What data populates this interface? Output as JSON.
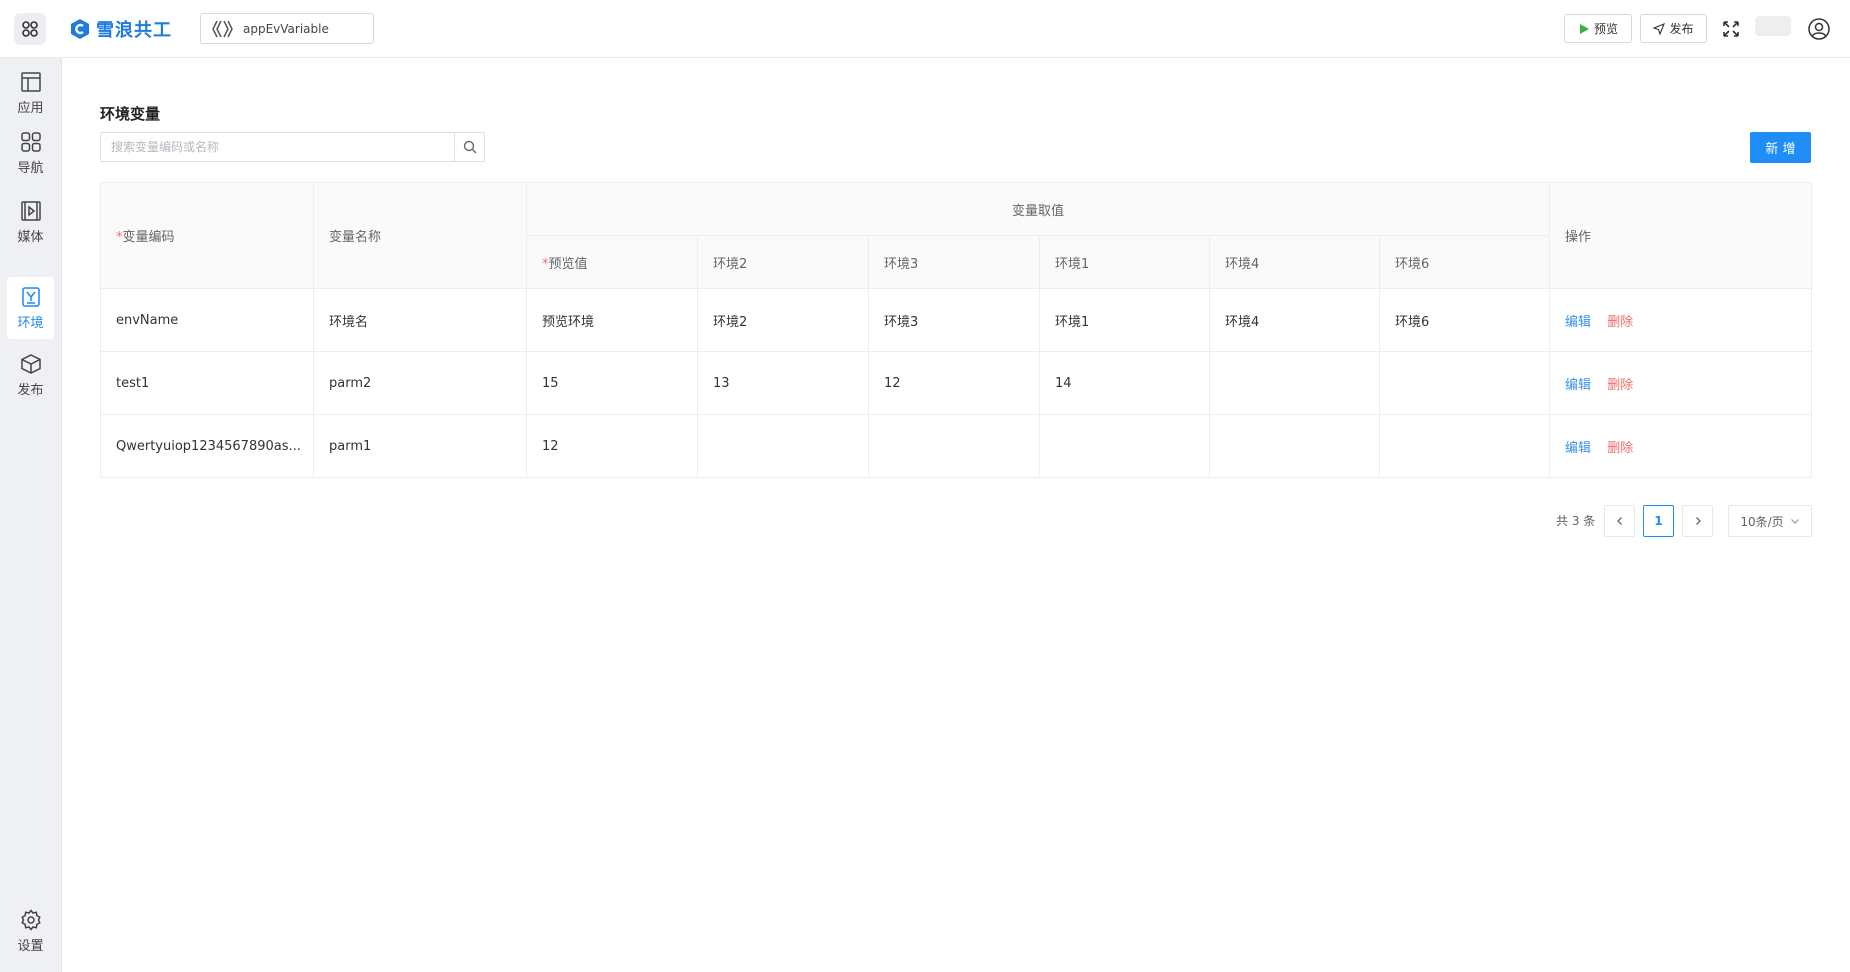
{
  "header": {
    "brand": "雪浪共工",
    "app_name": "appEvVariable",
    "preview_label": "预览",
    "publish_label": "发布"
  },
  "sidebar": {
    "items": [
      {
        "label": "应用",
        "icon": "layout-icon"
      },
      {
        "label": "导航",
        "icon": "grid-icon"
      },
      {
        "label": "媒体",
        "icon": "media-icon"
      },
      {
        "label": "环境",
        "icon": "env-icon",
        "active": true
      },
      {
        "label": "发布",
        "icon": "box-icon"
      }
    ],
    "settings_label": "设置"
  },
  "page": {
    "title": "环境变量",
    "search_placeholder": "搜索变量编码或名称",
    "add_label": "新 增"
  },
  "table": {
    "headers": {
      "code_req": "*",
      "code": "变量编码",
      "name": "变量名称",
      "values_group": "变量取值",
      "preview_req": "*",
      "preview": "预览值",
      "env2": "环境2",
      "env3": "环境3",
      "env1": "环境1",
      "env4": "环境4",
      "env6": "环境6",
      "ops": "操作"
    },
    "rows": [
      {
        "code": "envName",
        "name": "环境名",
        "preview": "预览环境",
        "env2": "环境2",
        "env3": "环境3",
        "env1": "环境1",
        "env4": "环境4",
        "env6": "环境6"
      },
      {
        "code": "test1",
        "name": "parm2",
        "preview": "15",
        "env2": "13",
        "env3": "12",
        "env1": "14",
        "env4": "",
        "env6": ""
      },
      {
        "code": "Qwertyuiop1234567890as...",
        "name": "parm1",
        "preview": "12",
        "env2": "",
        "env3": "",
        "env1": "",
        "env4": "",
        "env6": ""
      }
    ],
    "edit_label": "编辑",
    "delete_label": "删除"
  },
  "pagination": {
    "total_text": "共 3 条",
    "current_page": "1",
    "page_size": "10条/页"
  },
  "colors": {
    "accent": "#1e8df5",
    "danger": "#f26b6b",
    "brand": "#1f7be0"
  }
}
